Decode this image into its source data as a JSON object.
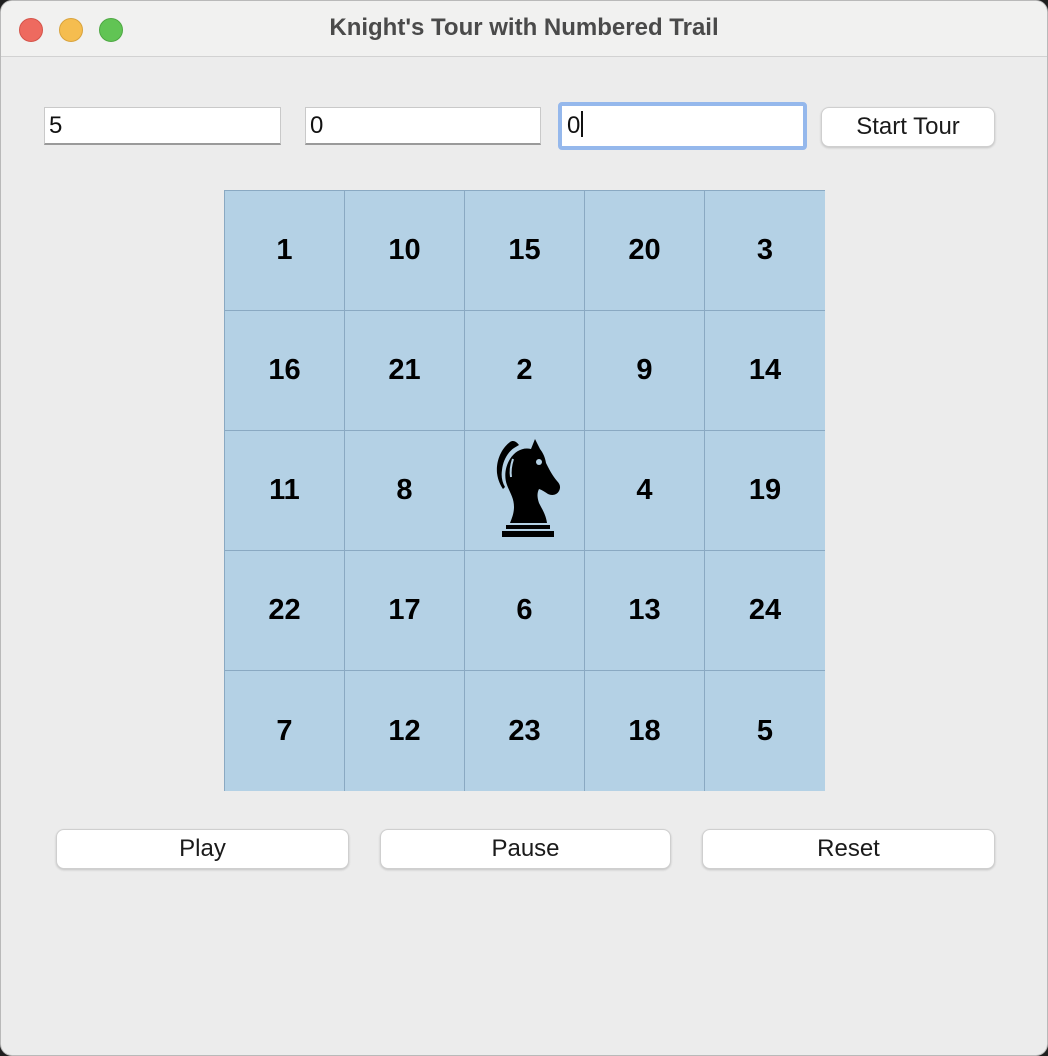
{
  "window": {
    "title": "Knight's Tour with Numbered Trail"
  },
  "inputs": {
    "board_size": "5",
    "start_row": "0",
    "start_col": "0"
  },
  "buttons": {
    "start_tour": "Start Tour",
    "play": "Play",
    "pause": "Pause",
    "reset": "Reset"
  },
  "board": {
    "rows": [
      [
        "1",
        "10",
        "15",
        "20",
        "3"
      ],
      [
        "16",
        "21",
        "2",
        "9",
        "14"
      ],
      [
        "11",
        "8",
        "",
        "4",
        "19"
      ],
      [
        "22",
        "17",
        "6",
        "13",
        "24"
      ],
      [
        "7",
        "12",
        "23",
        "18",
        "5"
      ]
    ],
    "knight_cell": "row 3, column 3",
    "knight_icon": "knight-icon",
    "cell_color": "#b4d1e5"
  }
}
